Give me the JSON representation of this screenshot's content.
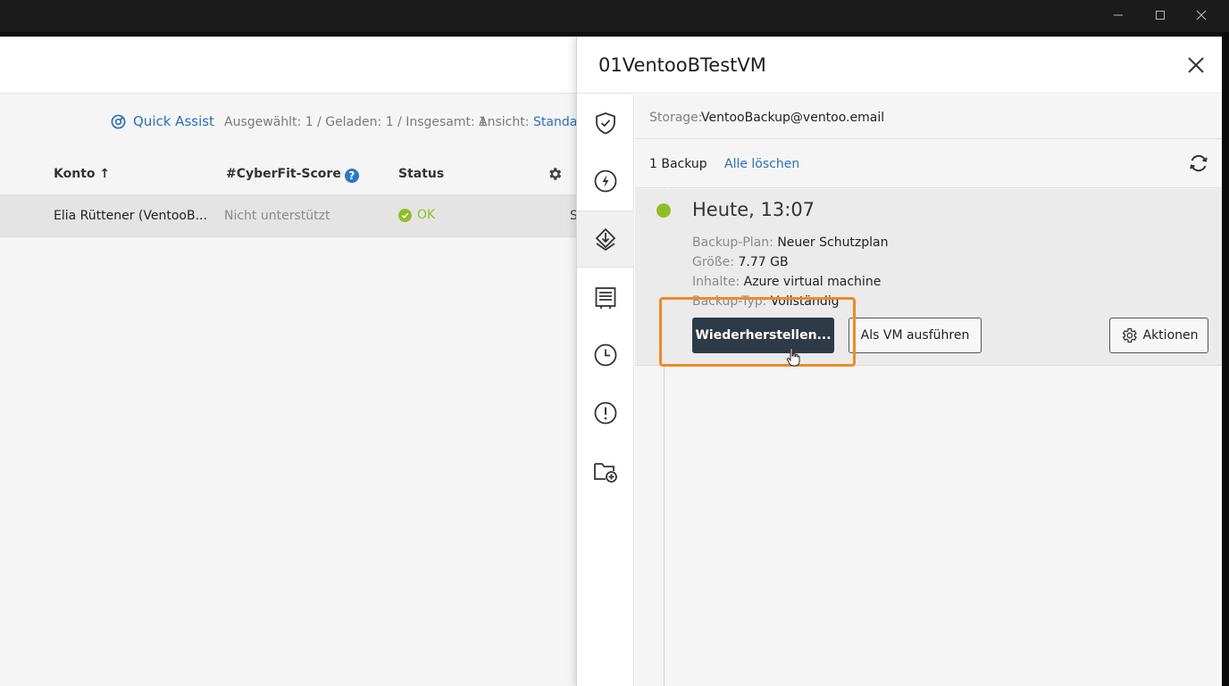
{
  "window": {
    "controls": {
      "minimize_icon": "minimize-icon",
      "maximize_icon": "maximize-icon",
      "close_icon": "close-icon"
    }
  },
  "toolbar": {
    "quick_assist": "Quick Assist",
    "selection_info": "Ausgewählt: 1 / Geladen: 1 / Insgesamt: 1",
    "view_label": "Ansicht:",
    "view_value": "Standar"
  },
  "table": {
    "columns": [
      "Konto ↑",
      "#CyberFit-Score",
      "Status"
    ],
    "help_glyph": "?",
    "rows": [
      {
        "account": "Elia Rüttener (VentooB...",
        "score": "Nicht unterstützt",
        "status": "OK",
        "extra": "S"
      }
    ]
  },
  "panel": {
    "title": "01VentooBTestVM",
    "nav_icons": [
      "shield-check-icon",
      "lightning-icon",
      "backup-storage-icon",
      "details-icon",
      "history-icon",
      "alert-icon",
      "folder-add-icon"
    ],
    "storage_label": "Storage:",
    "storage_value": "VentooBackup@ventoo.email",
    "backup_count": "1 Backup",
    "delete_all": "Alle löschen",
    "entry": {
      "time": "Heute, 13:07",
      "plan_label": "Backup-Plan:",
      "plan_value": "Neuer Schutzplan",
      "size_label": "Größe:",
      "size_value": "7.77 GB",
      "content_label": "Inhalte:",
      "content_value": "Azure virtual machine",
      "type_label": "Backup-Typ:",
      "type_value": "Vollständig",
      "restore_button": "Wiederherstellen...",
      "run_vm_button": "Als VM ausführen",
      "actions_button": "Aktionen"
    }
  },
  "colors": {
    "accent": "#2a6fb5",
    "ok": "#8fbf28",
    "primary_button": "#2e3a45",
    "highlight": "#f08a24"
  }
}
